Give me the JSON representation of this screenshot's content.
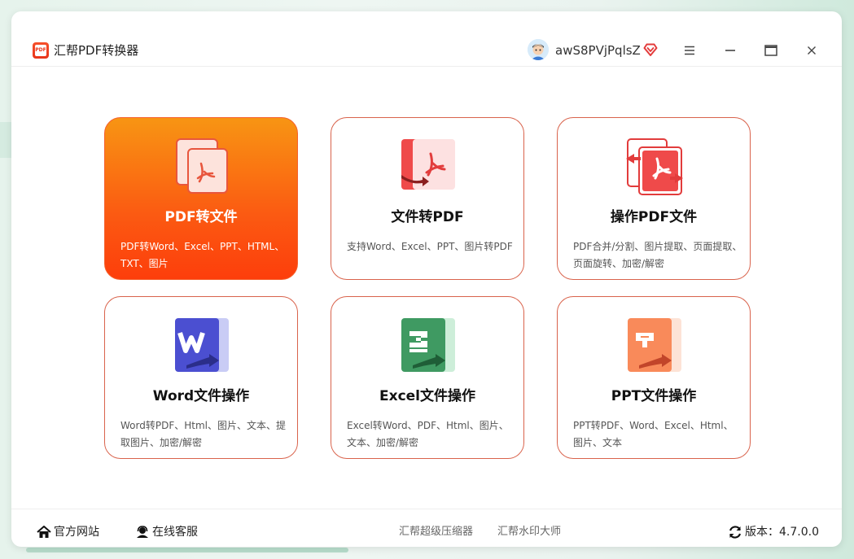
{
  "window": {
    "title": "汇帮PDF转换器",
    "logo_text": "PDF"
  },
  "user": {
    "name": "awS8PVjPqlsZ"
  },
  "cards": [
    {
      "title": "PDF转文件",
      "desc": "PDF转Word、Excel、PPT、HTML、TXT、图片",
      "icon": "pdf-to-file-icon",
      "active": true
    },
    {
      "title": "文件转PDF",
      "desc": "支持Word、Excel、PPT、图片转PDF",
      "icon": "file-to-pdf-icon",
      "active": false
    },
    {
      "title": "操作PDF文件",
      "desc": "PDF合并/分割、图片提取、页面提取、页面旋转、加密/解密",
      "icon": "pdf-operate-icon",
      "active": false
    },
    {
      "title": "Word文件操作",
      "desc": "Word转PDF、Html、图片、文本、提取图片、加密/解密",
      "icon": "word-icon",
      "active": false
    },
    {
      "title": "Excel文件操作",
      "desc": "Excel转Word、PDF、Html、图片、文本、加密/解密",
      "icon": "excel-icon",
      "active": false
    },
    {
      "title": "PPT文件操作",
      "desc": "PPT转PDF、Word、Excel、Html、图片、文本",
      "icon": "ppt-icon",
      "active": false
    }
  ],
  "footer": {
    "website": "官方网站",
    "service": "在线客服",
    "link1": "汇帮超级压缩器",
    "link2": "汇帮水印大师",
    "version": "版本：4.7.0.0"
  },
  "colors": {
    "accent": "#fb5a12",
    "card_border": "#d9634c"
  }
}
